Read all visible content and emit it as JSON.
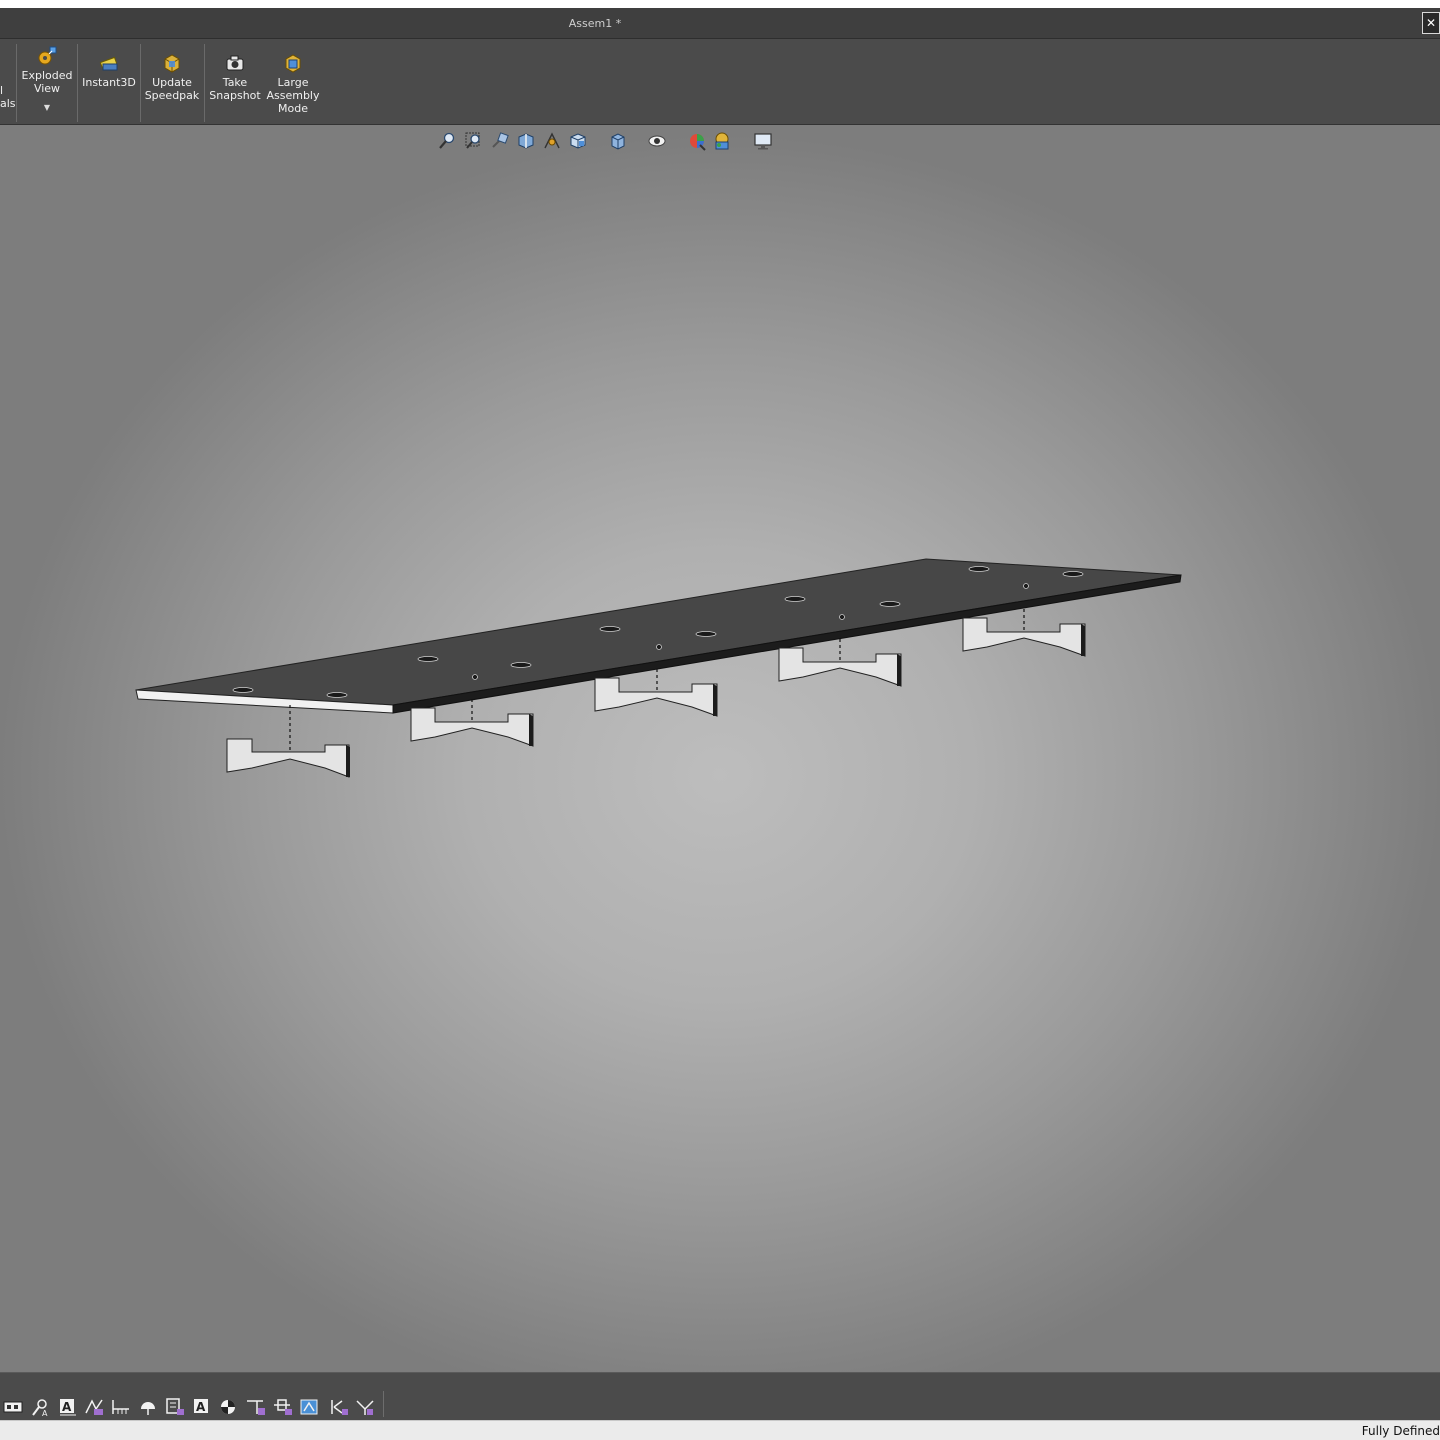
{
  "window": {
    "title": "Assem1 *",
    "close_glyph": "✕"
  },
  "ribbon": {
    "partial_label_line1": "l",
    "partial_label_line2": "als",
    "buttons": [
      {
        "label_lines": [
          "Exploded",
          "View"
        ],
        "icon": "exploded-view-icon",
        "has_dropdown": true
      },
      {
        "label_lines": [
          "Instant3D"
        ],
        "icon": "instant3d-icon",
        "has_dropdown": false
      },
      {
        "label_lines": [
          "Update",
          "Speedpak"
        ],
        "icon": "speedpak-icon",
        "has_dropdown": false
      },
      {
        "label_lines": [
          "Take",
          "Snapshot"
        ],
        "icon": "camera-icon",
        "has_dropdown": false
      },
      {
        "label_lines": [
          "Large",
          "Assembly",
          "Mode"
        ],
        "icon": "large-assembly-icon",
        "has_dropdown": false
      }
    ],
    "exploded": {
      "l1": "Exploded",
      "l2": "View"
    },
    "instant3d": {
      "l1": "Instant3D"
    },
    "speedpak": {
      "l1": "Update",
      "l2": "Speedpak"
    },
    "snapshot": {
      "l1": "Take",
      "l2": "Snapshot"
    },
    "large": {
      "l1": "Large",
      "l2": "Assembly",
      "l3": "Mode"
    }
  },
  "heads_up_toolbar": {
    "icons": [
      "zoom-to-fit-icon",
      "zoom-to-area-icon",
      "previous-view-icon",
      "section-view-icon",
      "dynamic-annotation-icon",
      "view-orientation-icon",
      "display-style-icon",
      "hide-show-icon",
      "edit-appearance-icon",
      "apply-scene-icon",
      "view-settings-icon"
    ]
  },
  "bottom_toolbar": {
    "icons": [
      "smart-dimension-icon",
      "note-icon",
      "balloon-icon",
      "surface-finish-icon",
      "weld-symbol-icon",
      "datum-icon",
      "geometric-tolerance-icon",
      "annotation-icon",
      "center-mark-icon",
      "hole-callout-icon",
      "datum-target-icon",
      "table-icon",
      "revision-icon",
      "format-icon"
    ]
  },
  "status": {
    "text": "Fully Defined"
  },
  "colors": {
    "ribbon_bg": "#4b4b4b",
    "viewport_center": "#bdbdbd",
    "plate_top": "#474747",
    "bracket_fill": "#e4e4e4"
  }
}
